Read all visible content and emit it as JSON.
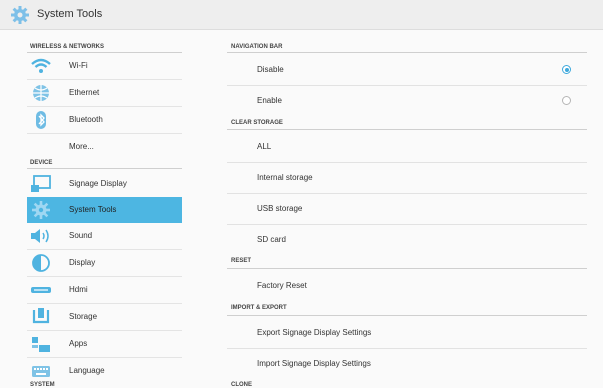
{
  "window": {
    "title": "System Tools"
  },
  "sidebar": {
    "sections": [
      {
        "heading": "WIRELESS & NETWORKS",
        "items": [
          {
            "label": "Wi-Fi",
            "icon": "wifi-icon"
          },
          {
            "label": "Ethernet",
            "icon": "ethernet-icon"
          },
          {
            "label": "Bluetooth",
            "icon": "bluetooth-icon"
          },
          {
            "label": "More...",
            "icon": ""
          }
        ]
      },
      {
        "heading": "DEVICE",
        "items": [
          {
            "label": "Signage Display",
            "icon": "display-cast-icon"
          },
          {
            "label": "System Tools",
            "icon": "gear-icon",
            "selected": true
          },
          {
            "label": "Sound",
            "icon": "speaker-icon"
          },
          {
            "label": "Display",
            "icon": "brightness-icon"
          },
          {
            "label": "Hdmi",
            "icon": "hdmi-icon"
          },
          {
            "label": "Storage",
            "icon": "storage-icon"
          },
          {
            "label": "Apps",
            "icon": "apps-icon"
          },
          {
            "label": "Language",
            "icon": "keyboard-icon"
          }
        ]
      },
      {
        "heading": "SYSTEM",
        "items": []
      }
    ]
  },
  "content": {
    "navigation_bar": {
      "heading": "NAVIGATION BAR",
      "options": [
        {
          "label": "Disable",
          "checked": true
        },
        {
          "label": "Enable",
          "checked": false
        }
      ]
    },
    "clear_storage": {
      "heading": "CLEAR STORAGE",
      "items": [
        "ALL",
        "Internal storage",
        "USB storage",
        "SD card"
      ]
    },
    "reset": {
      "heading": "RESET",
      "items": [
        "Factory Reset"
      ]
    },
    "import_export": {
      "heading": "IMPORT & EXPORT",
      "items": [
        "Export Signage Display Settings",
        "Import Signage Display Settings"
      ]
    },
    "clone": {
      "heading": "CLONE"
    }
  },
  "colors": {
    "accent": "#3da8dc",
    "selected_bg": "#4db6e2",
    "titlebar_bg": "#eeeeee"
  }
}
